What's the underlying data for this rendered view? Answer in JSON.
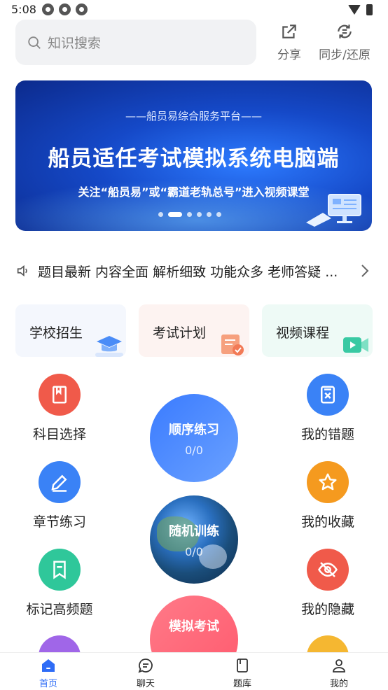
{
  "status_bar": {
    "time": "5:08"
  },
  "header": {
    "search_placeholder": "知识搜索",
    "share_label": "分享",
    "sync_label": "同步/还原"
  },
  "banner": {
    "subtitle": "——船员易综合服务平台——",
    "title": "船员适任考试模拟系统电脑端",
    "description": "关注“船员易”或“霸道老轨总号”进入视频课堂",
    "slide_count": 6,
    "active_slide": 2
  },
  "notice": {
    "text": "题目最新 内容全面 解析细致 功能众多 老师答疑 ..."
  },
  "cards": [
    {
      "label": "学校招生",
      "icon": "graduation-cap-icon",
      "bg": "#f4f7fd"
    },
    {
      "label": "考试计划",
      "icon": "calendar-check-icon",
      "bg": "#fdf3f1"
    },
    {
      "label": "视频课程",
      "icon": "video-camera-icon",
      "bg": "#eefaf6"
    }
  ],
  "menu_left": [
    {
      "label": "科目选择",
      "icon": "book-icon",
      "color": "#f05a4a"
    },
    {
      "label": "章节练习",
      "icon": "pencil-icon",
      "color": "#3a82f6"
    },
    {
      "label": "标记高频题",
      "icon": "bookmark-icon",
      "color": "#2fc79a"
    }
  ],
  "menu_right": [
    {
      "label": "我的错题",
      "icon": "wrong-answer-icon",
      "color": "#3a82f6"
    },
    {
      "label": "我的收藏",
      "icon": "star-icon",
      "color": "#f59a1f"
    },
    {
      "label": "我的隐藏",
      "icon": "eye-off-icon",
      "color": "#f05a4a"
    }
  ],
  "practice": [
    {
      "title": "顺序练习",
      "count": "0/0"
    },
    {
      "title": "随机训练",
      "count": "0/0"
    },
    {
      "title": "模拟考试"
    }
  ],
  "bottom_nav": [
    {
      "label": "首页",
      "icon": "home-icon",
      "active": true
    },
    {
      "label": "聊天",
      "icon": "chat-icon",
      "active": false
    },
    {
      "label": "题库",
      "icon": "question-bank-icon",
      "active": false
    },
    {
      "label": "我的",
      "icon": "user-icon",
      "active": false
    }
  ],
  "colors": {
    "accent": "#2e6cf6"
  }
}
